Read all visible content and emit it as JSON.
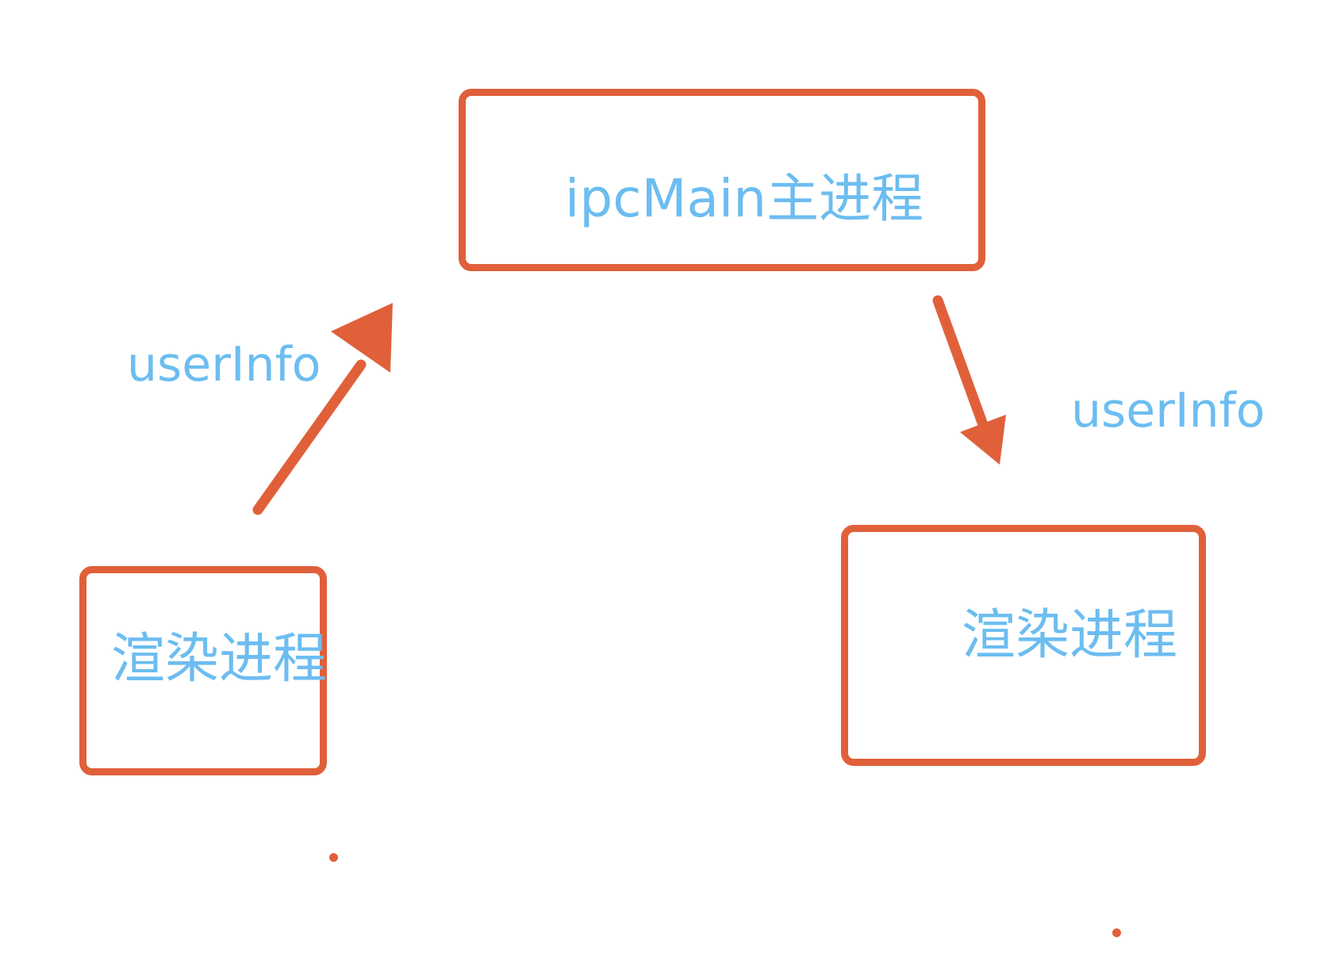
{
  "nodes": {
    "main_process": {
      "label": "ipcMain主进程"
    },
    "renderer_left": {
      "label": "渲染进程"
    },
    "renderer_right": {
      "label": "渲染进程"
    }
  },
  "edges": [
    {
      "from": "renderer_left",
      "to": "main_process",
      "label": "userInfo"
    },
    {
      "from": "main_process",
      "to": "renderer_right",
      "label": "userInfo"
    }
  ],
  "colors": {
    "box_border": "#E0603A",
    "arrow": "#E0603A",
    "text": "#6CBDF0"
  }
}
